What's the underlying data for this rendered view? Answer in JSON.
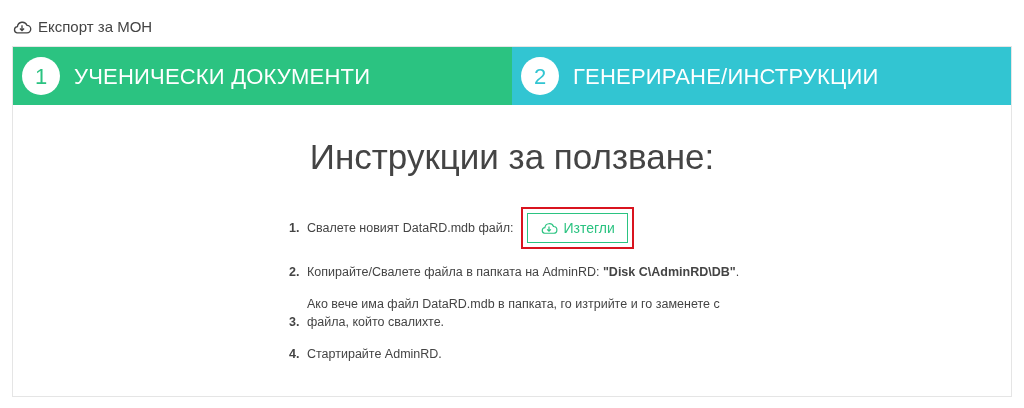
{
  "header": {
    "title": "Експорт за МОН"
  },
  "steps": [
    {
      "number": "1",
      "label": "УЧЕНИЧЕСКИ ДОКУМЕНТИ",
      "color": "#2bc381"
    },
    {
      "number": "2",
      "label": "ГЕНЕРИРАНЕ/ИНСТРУКЦИИ",
      "color": "#32c5d2"
    }
  ],
  "heading": "Инструкции за ползване:",
  "instructions": [
    {
      "number": "1.",
      "text": "Свалете новият DataRD.mdb файл:",
      "button": {
        "label": "Изтегли",
        "highlighted": true
      }
    },
    {
      "number": "2.",
      "text": "Копирайте/Свалете файла в папката на AdminRD: **\"Disk C\\AdminRD\\DB\"**."
    },
    {
      "number": "3.",
      "text": "Ако вече има файл DataRD.mdb в папката, го изтрийте и го заменете с файла, който свалихте."
    },
    {
      "number": "4.",
      "text": "Стартирайте AdminRD."
    }
  ]
}
